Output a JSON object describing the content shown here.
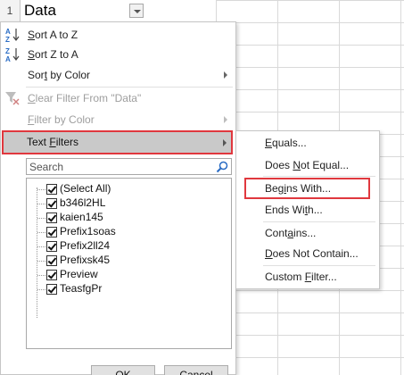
{
  "sheet": {
    "row_number": "1",
    "header_text": "Data"
  },
  "menu": {
    "sort_az": {
      "pre": "",
      "key": "S",
      "post": "ort A to Z"
    },
    "sort_za": {
      "pre": "",
      "key": "S",
      "post": "ort Z to A"
    },
    "sort_color": {
      "pre": "Sor",
      "key": "t",
      "post": " by Color"
    },
    "clear_filter": {
      "pre": "",
      "key": "C",
      "post": "lear Filter From \"Data\""
    },
    "filter_color": {
      "pre": "",
      "key": "F",
      "post": "ilter by Color"
    },
    "text_filters": {
      "pre": "",
      "key": "F",
      "post": "ilters",
      "prefix": "Text "
    },
    "search_placeholder": "Search",
    "list_items": [
      "(Select All)",
      "b346l2HL",
      "kaien145",
      "Prefix1soas",
      "Prefix2ll24",
      "Prefixsk45",
      "Preview",
      "TeasfgPr"
    ],
    "ok_label": "OK",
    "cancel_label": "Cancel"
  },
  "submenu": {
    "equals": {
      "pre": "",
      "key": "E",
      "post": "quals..."
    },
    "does_not_equal": {
      "pre": "Does ",
      "key": "N",
      "post": "ot Equal..."
    },
    "begins_with": {
      "pre": "Beg",
      "key": "i",
      "post": "ns With..."
    },
    "ends_with": {
      "pre": "Ends Wi",
      "key": "t",
      "post": "h..."
    },
    "contains": {
      "pre": "Cont",
      "key": "a",
      "post": "ins..."
    },
    "does_not_contain": {
      "pre": "",
      "key": "D",
      "post": "oes Not Contain..."
    },
    "custom_filter": {
      "pre": "Custom ",
      "key": "F",
      "post": "ilter..."
    }
  },
  "colors": {
    "highlight_border": "#e0383e",
    "selected_bg": "#c9c9c9",
    "sort_icon_blue": "#2a6cc4",
    "sort_icon_red": "#c23b3b"
  }
}
